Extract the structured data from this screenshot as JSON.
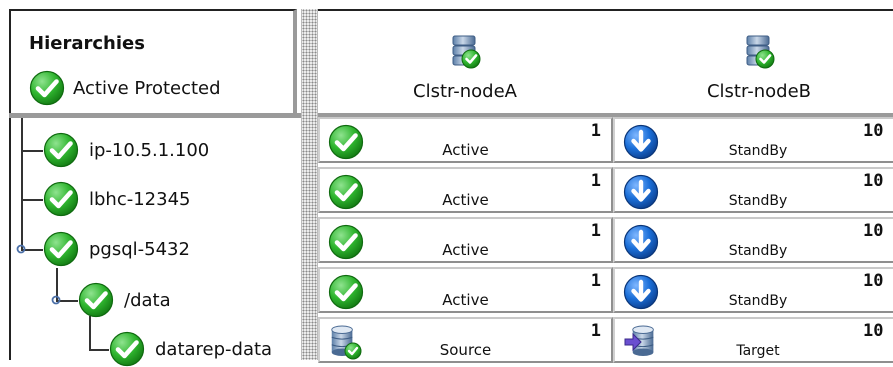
{
  "hierarchies": {
    "title": "Hierarchies",
    "status_label": "Active Protected"
  },
  "tree": [
    {
      "label": "ip-10.5.1.100",
      "icon": "active-check-icon"
    },
    {
      "label": "lbhc-12345",
      "icon": "active-check-icon"
    },
    {
      "label": "pgsql-5432",
      "icon": "active-check-icon"
    },
    {
      "label": "/data",
      "icon": "active-check-icon"
    },
    {
      "label": "datarep-data",
      "icon": "active-check-icon"
    }
  ],
  "nodes": [
    {
      "name": "Clstr-nodeA",
      "icon": "server-node-icon"
    },
    {
      "name": "Clstr-nodeB",
      "icon": "server-node-icon"
    }
  ],
  "rows": [
    {
      "a": {
        "state": "Active",
        "priority": "1",
        "icon": "active-check-icon"
      },
      "b": {
        "state": "StandBy",
        "priority": "10",
        "icon": "standby-arrow-icon"
      }
    },
    {
      "a": {
        "state": "Active",
        "priority": "1",
        "icon": "active-check-icon"
      },
      "b": {
        "state": "StandBy",
        "priority": "10",
        "icon": "standby-arrow-icon"
      }
    },
    {
      "a": {
        "state": "Active",
        "priority": "1",
        "icon": "active-check-icon"
      },
      "b": {
        "state": "StandBy",
        "priority": "10",
        "icon": "standby-arrow-icon"
      }
    },
    {
      "a": {
        "state": "Active",
        "priority": "1",
        "icon": "active-check-icon"
      },
      "b": {
        "state": "StandBy",
        "priority": "10",
        "icon": "standby-arrow-icon"
      }
    },
    {
      "a": {
        "state": "Source",
        "priority": "1",
        "icon": "source-disk-icon"
      },
      "b": {
        "state": "Target",
        "priority": "10",
        "icon": "target-disk-icon"
      }
    }
  ],
  "colors": {
    "active_green": "#2fb52f",
    "standby_blue": "#1b6fd8",
    "splitter_gray": "#9a9a9a"
  }
}
